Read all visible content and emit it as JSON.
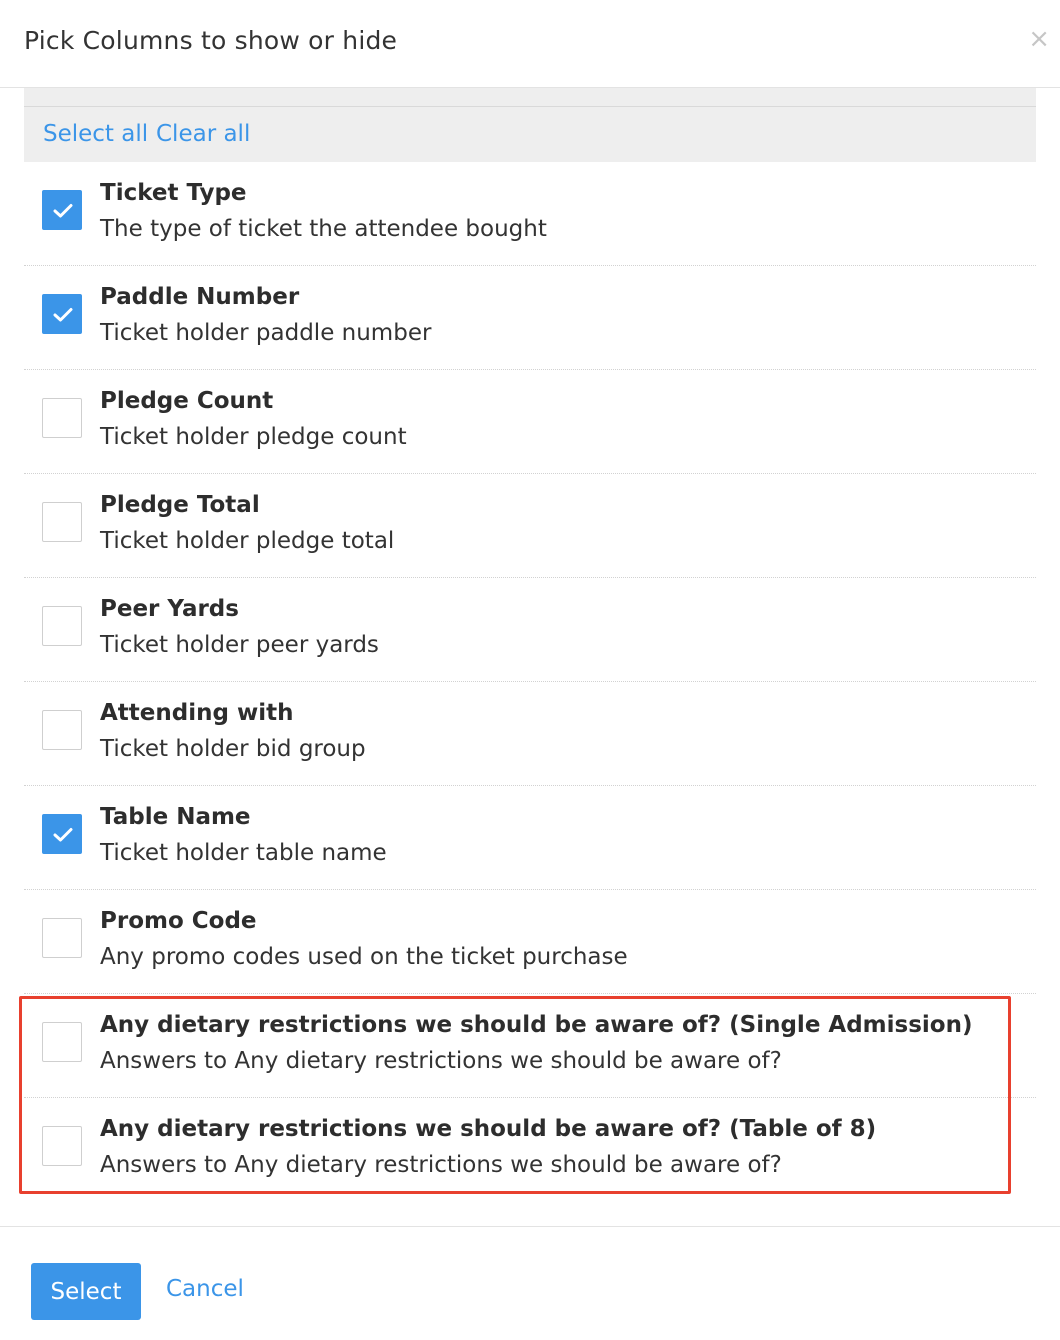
{
  "dialog": {
    "title": "Pick Columns to show or hide",
    "close_icon": "close-icon"
  },
  "toolbar": {
    "select_all": "Select all",
    "clear_all": "Clear all"
  },
  "columns": [
    {
      "title": "Ticket Type",
      "description": "The type of ticket the attendee bought",
      "checked": true
    },
    {
      "title": "Paddle Number",
      "description": "Ticket holder paddle number",
      "checked": true
    },
    {
      "title": "Pledge Count",
      "description": "Ticket holder pledge count",
      "checked": false
    },
    {
      "title": "Pledge Total",
      "description": "Ticket holder pledge total",
      "checked": false
    },
    {
      "title": "Peer Yards",
      "description": "Ticket holder peer yards",
      "checked": false
    },
    {
      "title": "Attending with",
      "description": "Ticket holder bid group",
      "checked": false
    },
    {
      "title": "Table Name",
      "description": "Ticket holder table name",
      "checked": true
    },
    {
      "title": "Promo Code",
      "description": "Any promo codes used on the ticket purchase",
      "checked": false
    },
    {
      "title": "Any dietary restrictions we should be aware of? (Single Admission)",
      "description": "Answers to Any dietary restrictions we should be aware of?",
      "checked": false
    },
    {
      "title": "Any dietary restrictions we should be aware of? (Table of 8)",
      "description": "Answers to Any dietary restrictions we should be aware of?",
      "checked": false
    }
  ],
  "footer": {
    "select_label": "Select",
    "cancel_label": "Cancel"
  },
  "colors": {
    "accent": "#3b95e8",
    "highlight": "#e8402e"
  }
}
